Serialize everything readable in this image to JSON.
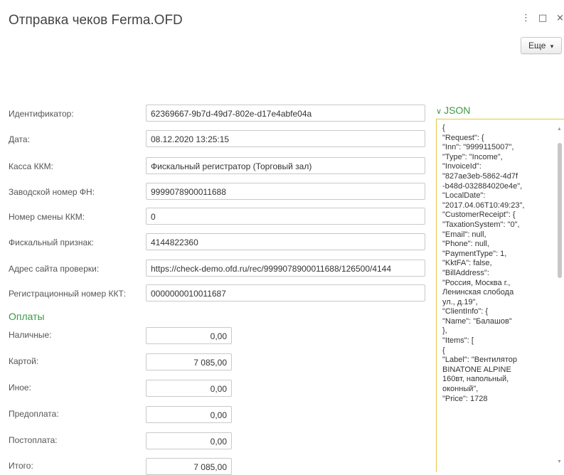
{
  "window": {
    "title": "Отправка чеков Ferma.OFD",
    "more_icon": "⋮",
    "maximize_icon": "□",
    "close_icon": "×"
  },
  "toolbar": {
    "more_label": "Еще",
    "more_arrow": "▾"
  },
  "fields": [
    {
      "label": "Идентификатор:",
      "value": "62369667-9b7d-49d7-802e-d17e4abfe04a"
    },
    {
      "label": "Дата:",
      "value": "08.12.2020 13:25:15"
    },
    {
      "label": "Касса ККМ:",
      "value": "Фискальный регистратор (Торговый зал)"
    },
    {
      "label": "Заводской номер ФН:",
      "value": "9999078900011688"
    },
    {
      "label": "Номер смены ККМ:",
      "value": "0"
    },
    {
      "label": "Фискальный признак:",
      "value": "4144822360"
    },
    {
      "label": "Адрес сайта проверки:",
      "value": "https://check-demo.ofd.ru/rec/9999078900011688/126500/4144"
    },
    {
      "label": "Регистрационный номер ККТ:",
      "value": "0000000010011687"
    }
  ],
  "payments": {
    "title": "Оплаты",
    "items": [
      {
        "label": "Наличные:",
        "value": "0,00"
      },
      {
        "label": "Картой:",
        "value": "7 085,00"
      },
      {
        "label": "Иное:",
        "value": "0,00"
      },
      {
        "label": "Предоплата:",
        "value": "0,00"
      },
      {
        "label": "Постоплата:",
        "value": "0,00"
      },
      {
        "label": "Итого:",
        "value": "7 085,00"
      }
    ]
  },
  "json_panel": {
    "title": "JSON",
    "content": "{\n\"Request\": {\n\"Inn\": \"9999115007\",\n\"Type\": \"Income\",\n\"InvoiceId\":\n\"827ae3eb-5862-4d7f\n-b48d-032884020e4e\",\n\"LocalDate\":\n\"2017.04.06T10:49:23\",\n\"CustomerReceipt\": {\n\"TaxationSystem\": \"0\",\n\"Email\": null,\n\"Phone\": null,\n\"PaymentType\": 1,\n\"KktFA\": false,\n\"BillAddress\":\n\"Россия, Москва г.,\nЛенинская слобода\nул., д.19\",\n\"ClientInfo\": {\n\"Name\": \"Балашов\"\n},\n\"Items\": [\n{\n\"Label\": \"Вентилятор\nBINATONE ALPINE\n160вт, напольный,\nоконный\",\n\"Price\": 1728"
  }
}
